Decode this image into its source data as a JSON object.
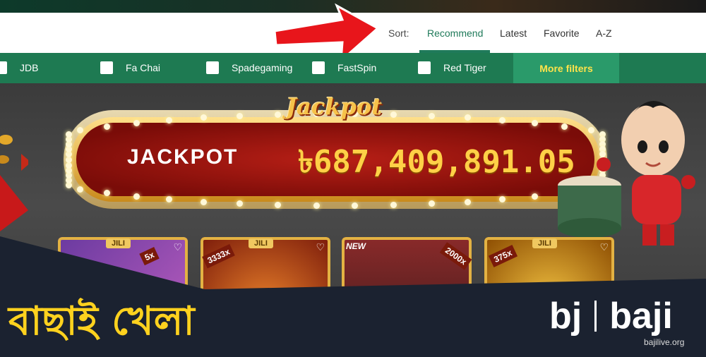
{
  "sort": {
    "label": "Sort:",
    "options": [
      "Recommend",
      "Latest",
      "Favorite",
      "A-Z"
    ],
    "active": "Recommend"
  },
  "filters": {
    "providers": [
      "JDB",
      "Fa Chai",
      "Spadegaming",
      "FastSpin",
      "Red Tiger"
    ],
    "more_label": "More filters"
  },
  "jackpot": {
    "logo": "Jackpot",
    "word": "JACKPOT",
    "amount": "৳687,409,891.05"
  },
  "games": [
    {
      "provider": "JILI",
      "multiplier": "5x",
      "is_new": false
    },
    {
      "provider": "JILI",
      "multiplier": "3333x",
      "is_new": false
    },
    {
      "provider": "",
      "multiplier": "2000x",
      "is_new": true,
      "new_label": "NEW"
    },
    {
      "provider": "JILI",
      "multiplier": "375x",
      "is_new": false
    }
  ],
  "caption": "বাছাই খেলা",
  "brand": {
    "short": "bj",
    "full": "baji"
  },
  "watermark": "bajilive.org",
  "colors": {
    "accent": "#1f7a5a",
    "filter_bg": "#1e7a52",
    "more_filters_text": "#ffe34a",
    "caption": "#ffd21e",
    "arrow": "#e8151b"
  }
}
